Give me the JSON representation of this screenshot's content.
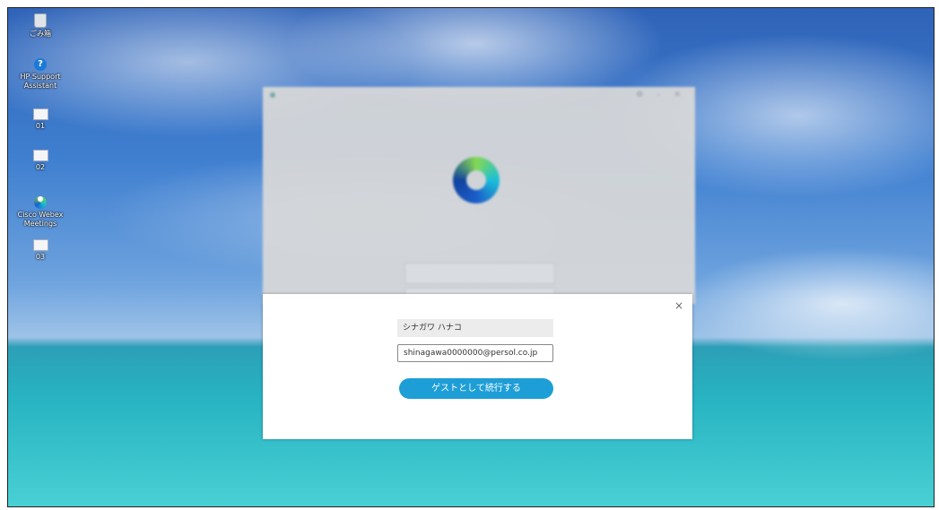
{
  "desktop": {
    "icons": [
      {
        "label": "ごみ箱",
        "icon": "recycle-bin-icon"
      },
      {
        "label": "HP Support Assistant",
        "icon": "help-icon"
      },
      {
        "label": "01",
        "icon": "document-icon"
      },
      {
        "label": "02",
        "icon": "document-icon"
      },
      {
        "label": "Cisco Webex Meetings",
        "icon": "webex-icon"
      },
      {
        "label": "03",
        "icon": "document-icon"
      }
    ]
  },
  "background_window": {
    "app_icon": "webex-logo-icon"
  },
  "dialog": {
    "close_symbol": "×",
    "name_value": "シナガワ ハナコ",
    "email_value": "shinagawa0000000@persol.co.jp",
    "guest_button_label": "ゲストとして続行する",
    "accent_color": "#1e9ed6"
  }
}
